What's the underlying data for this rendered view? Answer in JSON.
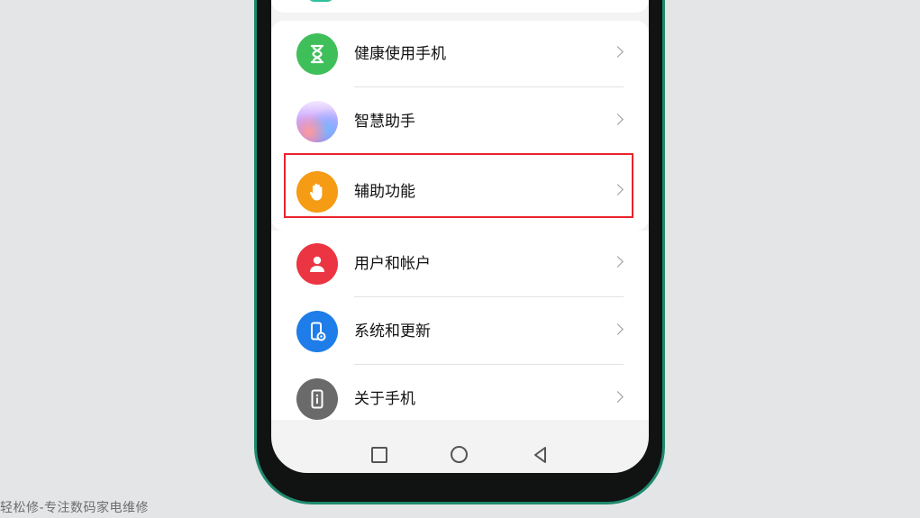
{
  "settings": {
    "items": [
      {
        "label": "健康使用手机",
        "icon": "hourglass-icon",
        "color": "#3fbf5a"
      },
      {
        "label": "智慧助手",
        "icon": "assistant-gradient-icon",
        "color": "#b98de0"
      },
      {
        "label": "辅助功能",
        "icon": "hand-icon",
        "color": "#f59b14"
      },
      {
        "label": "用户和帐户",
        "icon": "user-icon",
        "color": "#eb3542"
      },
      {
        "label": "系统和更新",
        "icon": "phone-settings-icon",
        "color": "#1e7de8"
      },
      {
        "label": "关于手机",
        "icon": "phone-info-icon",
        "color": "#6a6a6a"
      }
    ],
    "highlighted_item": "辅助功能",
    "highlight_color": "#e8232d"
  },
  "navbar": {
    "buttons": [
      "recents-square-icon",
      "home-circle-icon",
      "back-triangle-icon"
    ]
  },
  "watermark": "轻松修-专注数码家电维修",
  "colors": {
    "background": "#e4e5e7",
    "phone_frame_accent": "#1f8a6e"
  }
}
